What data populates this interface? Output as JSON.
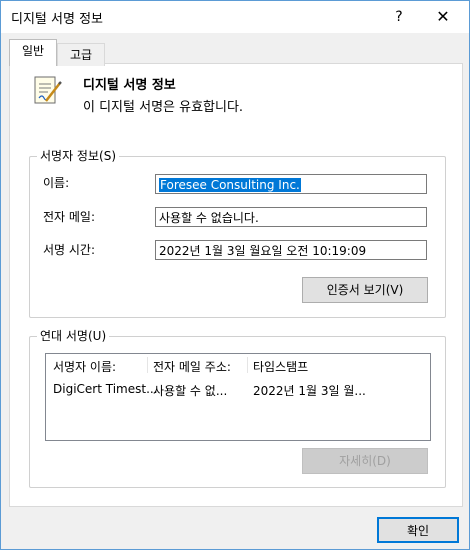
{
  "window": {
    "title": "디지털 서명 정보",
    "help_label": "?",
    "close_label": "✕"
  },
  "tabs": [
    {
      "label": "일반"
    },
    {
      "label": "고급"
    }
  ],
  "info": {
    "title": "디지털 서명 정보",
    "subtitle": "이 디지털 서명은 유효합니다."
  },
  "signer": {
    "group_label": "서명자 정보(S)",
    "name_label": "이름:",
    "name_value": "Foresee Consulting Inc.",
    "email_label": "전자 메일:",
    "email_value": "사용할 수 없습니다.",
    "time_label": "서명 시간:",
    "time_value": "2022년 1월 3일 월요일 오전 10:19:09",
    "view_cert_button": "인증서 보기(V)"
  },
  "countersign": {
    "group_label": "연대 서명(U)",
    "columns": [
      "서명자 이름:",
      "전자 메일 주소:",
      "타임스탬프"
    ],
    "rows": [
      [
        "DigiCert Timest...",
        "사용할 수 없...",
        "2022년 1월 3일 월..."
      ]
    ],
    "details_button": "자세히(D)"
  },
  "footer": {
    "ok_button": "확인"
  },
  "icons": {
    "help": "help-icon",
    "close": "close-icon",
    "certificate": "signed-document-icon"
  }
}
